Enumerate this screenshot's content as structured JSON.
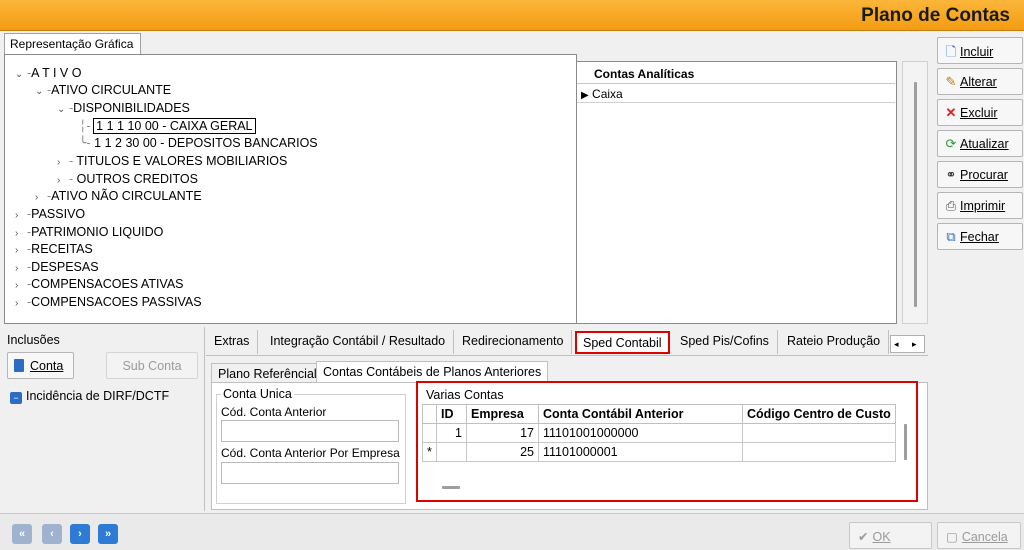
{
  "window": {
    "title": "Plano de Contas"
  },
  "tree_tab": {
    "label": "Representação Gráfica"
  },
  "tree": [
    {
      "label": "A T I V O",
      "chevron": "v"
    },
    {
      "label": "ATIVO CIRCULANTE",
      "chevron": "v"
    },
    {
      "label": "DISPONIBILIDADES",
      "chevron": "v"
    },
    {
      "label": "1 1 1 10 00 - CAIXA GERAL",
      "chevron": ""
    },
    {
      "label": "1 1 2 30 00 - DEPOSITOS BANCARIOS",
      "chevron": ""
    },
    {
      "label": "TITULOS E VALORES MOBILIARIOS",
      "chevron": ">"
    },
    {
      "label": "OUTROS CREDITOS",
      "chevron": ">"
    },
    {
      "label": "ATIVO NÃO CIRCULANTE",
      "chevron": ">"
    },
    {
      "label": "PASSIVO",
      "chevron": ">"
    },
    {
      "label": "PATRIMONIO LIQUIDO",
      "chevron": ">"
    },
    {
      "label": "RECEITAS",
      "chevron": ">"
    },
    {
      "label": "DESPESAS",
      "chevron": ">"
    },
    {
      "label": "COMPENSACOES ATIVAS",
      "chevron": ">"
    },
    {
      "label": "COMPENSACOES PASSIVAS",
      "chevron": ">"
    }
  ],
  "analiticas": {
    "header": "Contas Analíticas",
    "rows": [
      "Caixa"
    ]
  },
  "side_buttons": [
    {
      "label": "Incluir",
      "icon": "new-document-icon"
    },
    {
      "label": "Alterar",
      "icon": "edit-icon"
    },
    {
      "label": "Excluir",
      "icon": "delete-x-icon"
    },
    {
      "label": "Atualizar",
      "icon": "refresh-icon"
    },
    {
      "label": "Procurar",
      "icon": "binoculars-icon"
    },
    {
      "label": "Imprimir",
      "icon": "printer-icon"
    },
    {
      "label": "Fechar",
      "icon": "close-window-icon"
    }
  ],
  "inclusoes": {
    "title": "Inclusões",
    "conta_button": "Conta",
    "subconta_button": "Sub Conta",
    "checkbox_label": "Incidência de DIRF/DCTF"
  },
  "tabs": [
    "Extras",
    "Integração Contábil / Resultado",
    "Redirecionamento",
    "Sped Contabil",
    "Sped Pis/Cofins",
    "Rateio Produção"
  ],
  "active_tab": "Sped Contabil",
  "subtabs": [
    "Plano Referêncial",
    "Contas Contábeis de Planos Anteriores"
  ],
  "conta_unica": {
    "title": "Conta Unica",
    "field1_label": "Cód. Conta Anterior",
    "field2_label": "Cód. Conta Anterior Por Empresa"
  },
  "varias_contas": {
    "title": "Varias Contas",
    "columns": [
      "ID",
      "Empresa",
      "Conta Contábil Anterior",
      "Código Centro de Custo"
    ],
    "rows": [
      {
        "marker": "",
        "id": "1",
        "empresa": "17",
        "conta": "11101001000000",
        "centro": ""
      },
      {
        "marker": "*",
        "id": "",
        "empresa": "25",
        "conta": "11101000001",
        "centro": ""
      }
    ]
  },
  "footer": {
    "ok_label": "OK",
    "cancel_label": "Cancela"
  },
  "colors": {
    "accent": "#f39c12",
    "highlight": "#e00000",
    "nav": "#2e7bd6"
  }
}
